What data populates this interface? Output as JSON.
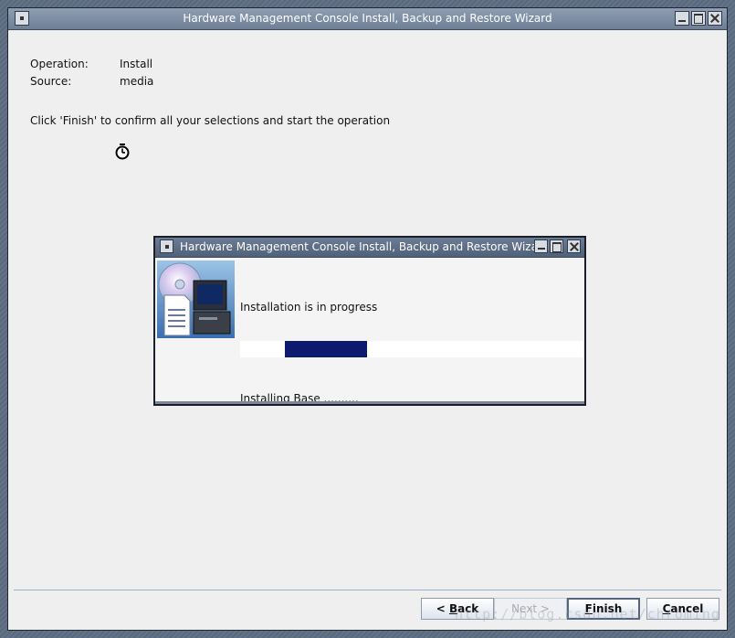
{
  "window": {
    "title": "Hardware Management Console Install, Backup and Restore Wizard"
  },
  "summary": {
    "operation_label": "Operation:",
    "operation_value": "Install",
    "source_label": "Source:",
    "source_value": "media",
    "instruction": "Click 'Finish' to confirm all your selections and start the operation"
  },
  "progress_dialog": {
    "title": "Hardware Management Console Install, Backup and Restore Wizard",
    "status": "Installation is in progress",
    "detail": "Installing Base ..........",
    "progress_fraction": 0.24,
    "progress_offset_fraction": 0.13,
    "progress_color": "#0d1a6e"
  },
  "buttons": {
    "back_prefix": "< ",
    "back_mnemonic": "B",
    "back_rest": "ack",
    "next_label": "Next >",
    "finish_mnemonic": "F",
    "finish_rest": "inish",
    "cancel_mnemonic": "C",
    "cancel_rest": "ancel"
  },
  "watermark": "http://blog.csdn.net/chroming",
  "icons": {
    "busy_cursor": "stopwatch-cursor-icon",
    "install_art": "computer-install-icon"
  }
}
